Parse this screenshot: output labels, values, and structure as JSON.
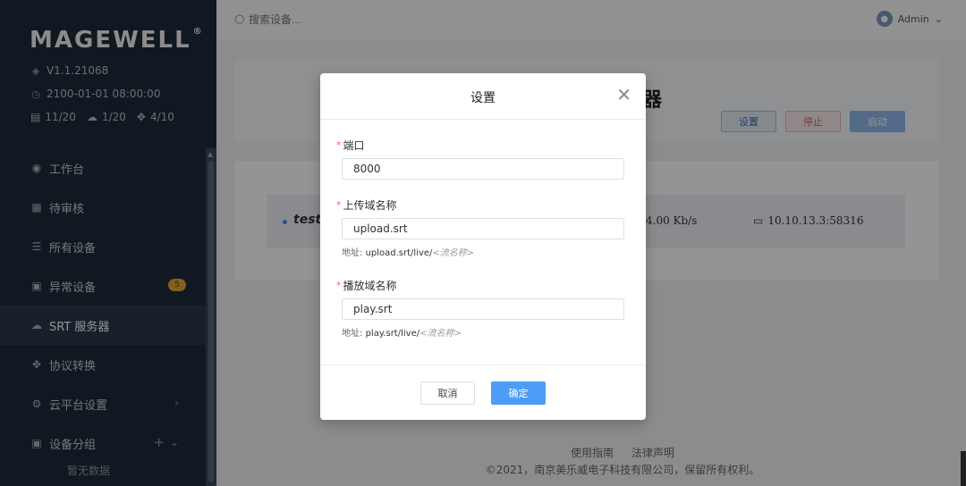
{
  "sidebar": {
    "logo": "MAGEWELL",
    "logo_mark": "®",
    "version": "V1.1.21068",
    "datetime": "2100-01-01 08:00:00",
    "stats": {
      "devices": "11/20",
      "cloud": "1/20",
      "protocol": "4/10"
    },
    "items": [
      {
        "label": "工作台",
        "icon": "dashboard-icon"
      },
      {
        "label": "待审核",
        "icon": "clipboard-icon"
      },
      {
        "label": "所有设备",
        "icon": "list-icon"
      },
      {
        "label": "异常设备",
        "icon": "warning-doc-icon",
        "badge": "5"
      },
      {
        "label": "SRT 服务器",
        "icon": "cloud-icon"
      },
      {
        "label": "协议转换",
        "icon": "convert-icon"
      },
      {
        "label": "云平台设置",
        "icon": "gear-icon"
      },
      {
        "label": "设备分组",
        "icon": "group-icon"
      }
    ],
    "sub_empty": "暂无数据"
  },
  "topbar": {
    "search_placeholder": "搜索设备...",
    "user": "Admin"
  },
  "main": {
    "header_glyph": "器",
    "buttons": {
      "settings": "设置",
      "stop": "停止",
      "start": "启动"
    },
    "row": {
      "name": "test:",
      "rate": "4.00 Kb/s",
      "ip": "10.10.13.3:58316"
    }
  },
  "footer": {
    "guide": "使用指南",
    "legal": "法律声明",
    "copyright": "©2021，南京美乐威电子科技有限公司，保留所有权利。"
  },
  "modal": {
    "title": "设置",
    "port_label": "端口",
    "port_value": "8000",
    "upload_label": "上传域名称",
    "upload_value": "upload.srt",
    "upload_hint_prefix": "地址: ",
    "upload_hint_addr": "upload.srt/live/",
    "upload_hint_ph": "<流名称>",
    "play_label": "播放域名称",
    "play_value": "play.srt",
    "play_hint_prefix": "地址: ",
    "play_hint_addr": "play.srt/live/",
    "play_hint_ph": "<流名称>",
    "cancel": "取消",
    "ok": "确定",
    "required_mark": "*"
  },
  "colors": {
    "accent": "#4e9cf5",
    "sidebar": "#1d2b3a",
    "badge": "#e6a23c",
    "required": "#f56c6c"
  }
}
